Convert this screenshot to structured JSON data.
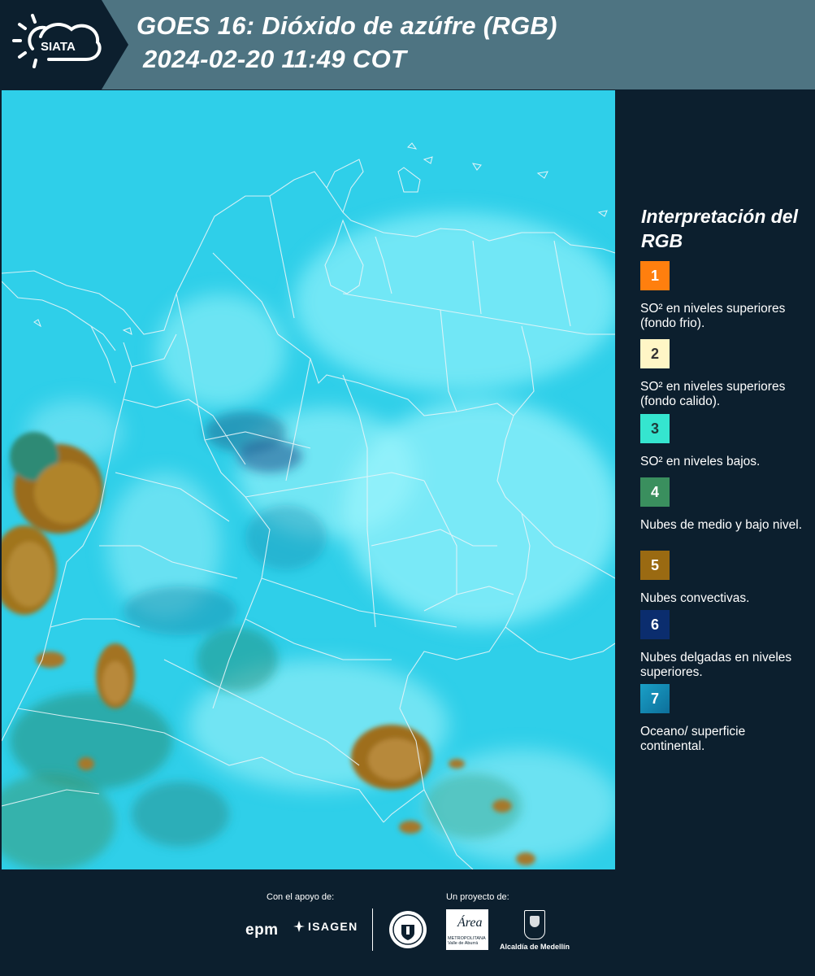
{
  "header": {
    "logo_text": "SIATA",
    "title_line1": "GOES 16: Dióxido de azúfre (RGB)",
    "title_line2": "2024-02-20 11:49 COT"
  },
  "map": {
    "background_color": "#2fd0ea",
    "border_color": "#e8f4f8"
  },
  "legend": {
    "title": "Interpretación del RGB",
    "items": [
      {
        "number": "1",
        "color": "#ff7f0e",
        "number_color": "#ffffff",
        "text": "SO² en niveles superiores (fondo frio)."
      },
      {
        "number": "2",
        "color": "#fff6c6",
        "number_color": "#333333",
        "text": "SO² en niveles superiores (fondo calido)."
      },
      {
        "number": "3",
        "color": "#35e5cf",
        "number_color": "#1e3a3a",
        "text": "SO² en niveles bajos."
      },
      {
        "number": "4",
        "color": "#3a8f5e",
        "number_color": "#ffffff",
        "text": "Nubes de medio y bajo nivel."
      },
      {
        "number": "5",
        "color": "#9a6a12",
        "number_color": "#ffffff",
        "text": "Nubes convectivas."
      },
      {
        "number": "6",
        "color": "#0b2d6e",
        "number_color": "#ffffff",
        "text": "Nubes delgadas en niveles superiores."
      },
      {
        "number": "7",
        "color": "#1aa0c7",
        "number_color": "#ffffff",
        "text": "Oceano/ superficie continental."
      }
    ]
  },
  "footer": {
    "support_caption": "Con el apoyo de:",
    "project_caption": "Un proyecto de:",
    "epm": "epm",
    "isagen": "ISAGEN",
    "area_word": "Área",
    "area_sub": "METROPOLITANA Valle de Aburrá",
    "medellin": "Alcaldía de Medellín"
  }
}
